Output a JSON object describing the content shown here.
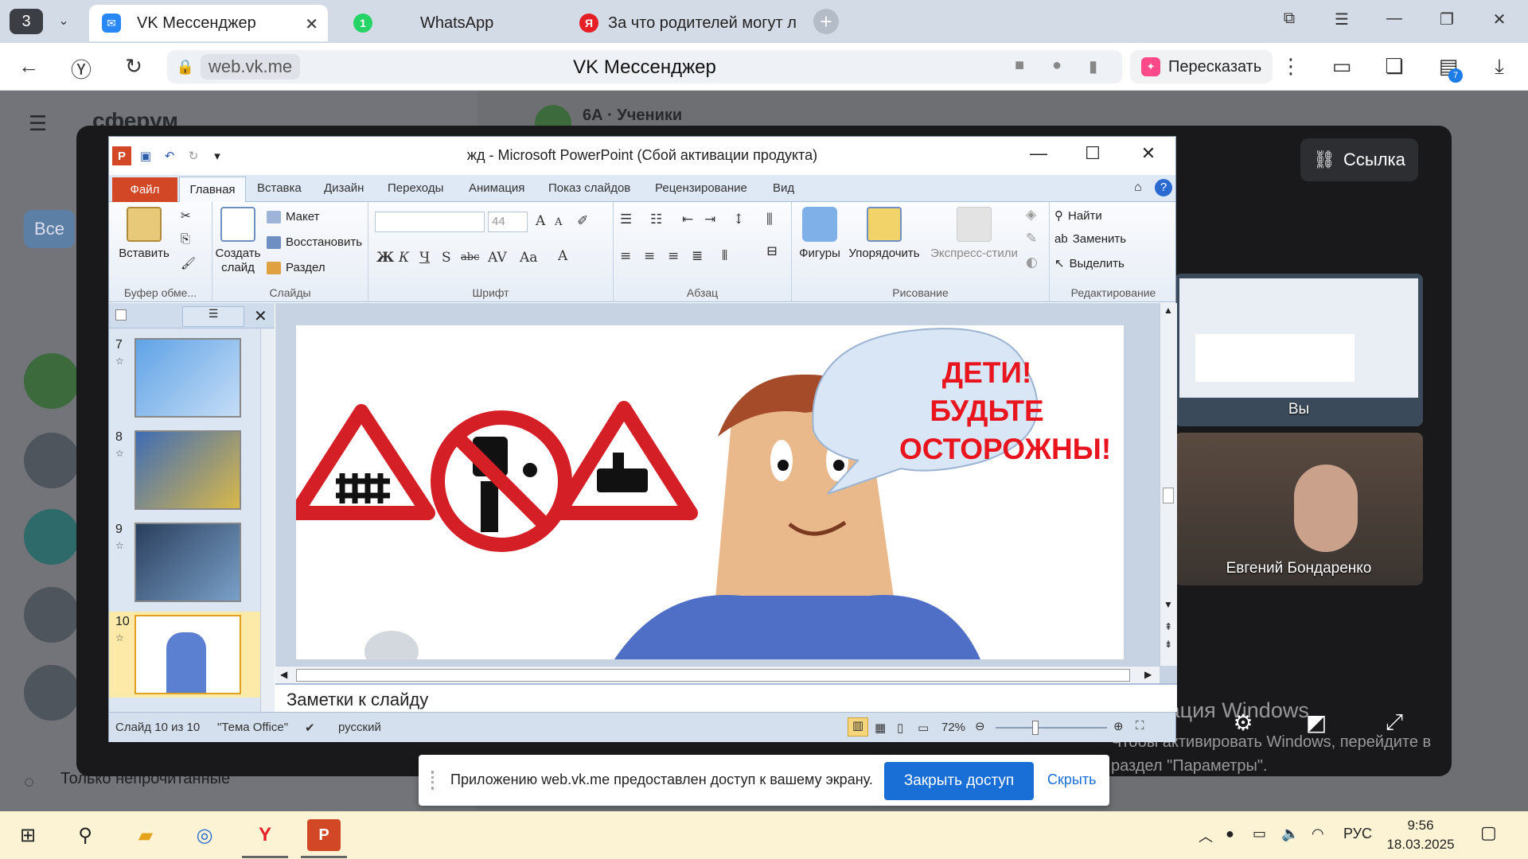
{
  "browser": {
    "tab_count": "3",
    "tabs": [
      {
        "label": "VK Мессенджер"
      },
      {
        "label": "WhatsApp"
      },
      {
        "label": "За что родителей могут л"
      }
    ],
    "address": {
      "domain": "web.vk.me",
      "page_title": "VK Мессенджер"
    },
    "retell_label": "Пересказать",
    "downloads_badge": "7"
  },
  "vk": {
    "brand": "сферум",
    "chat_title": "6А · Ученики",
    "filter_all": "Все",
    "unread_only": "Только непрочитанные"
  },
  "call": {
    "link_button": "Ссылка",
    "you_label": "Вы",
    "participant_name": "Евгений Бондаренко",
    "activation_title": "Активация Windows",
    "activation_text": "Чтобы активировать Windows, перейдите в раздел \"Параметры\"."
  },
  "ppt": {
    "window_title": "жд - Microsoft PowerPoint (Сбой активации продукта)",
    "tabs": [
      "Файл",
      "Главная",
      "Вставка",
      "Дизайн",
      "Переходы",
      "Анимация",
      "Показ слайдов",
      "Рецензирование",
      "Вид"
    ],
    "ribbon": {
      "clipboard": {
        "paste": "Вставить",
        "group": "Буфер обме..."
      },
      "slides": {
        "new_slide": "Создать слайд",
        "layout": "Макет",
        "reset": "Восстановить",
        "section": "Раздел",
        "group": "Слайды"
      },
      "font": {
        "size": "44",
        "group": "Шрифт"
      },
      "paragraph": {
        "group": "Абзац"
      },
      "drawing": {
        "shapes": "Фигуры",
        "arrange": "Упорядочить",
        "quick_styles": "Экспресс-стили",
        "group": "Рисование"
      },
      "editing": {
        "find": "Найти",
        "replace": "Заменить",
        "select": "Выделить",
        "group": "Редактирование"
      }
    },
    "thumbnails": [
      {
        "num": "7",
        "selected": false
      },
      {
        "num": "8",
        "selected": false
      },
      {
        "num": "9",
        "selected": false
      },
      {
        "num": "10",
        "selected": true
      }
    ],
    "slide_text": [
      "ДЕТИ!",
      "БУДЬТЕ",
      "ОСТОРОЖНЫ!"
    ],
    "notes_placeholder": "Заметки к слайду",
    "status": {
      "slide": "Слайд 10 из 10",
      "theme": "\"Тема Office\"",
      "lang": "русский",
      "zoom": "72%"
    }
  },
  "share_bar": {
    "message": "Приложению web.vk.me предоставлен доступ к вашему экрану.",
    "stop_button": "Закрыть доступ",
    "hide_link": "Скрыть"
  },
  "taskbar": {
    "lang": "РУС",
    "time": "9:56",
    "date": "18.03.2025"
  },
  "colors": {
    "ppt_accent": "#d24726",
    "share_blue": "#1a6fd6",
    "slide_red": "#e8141e"
  }
}
